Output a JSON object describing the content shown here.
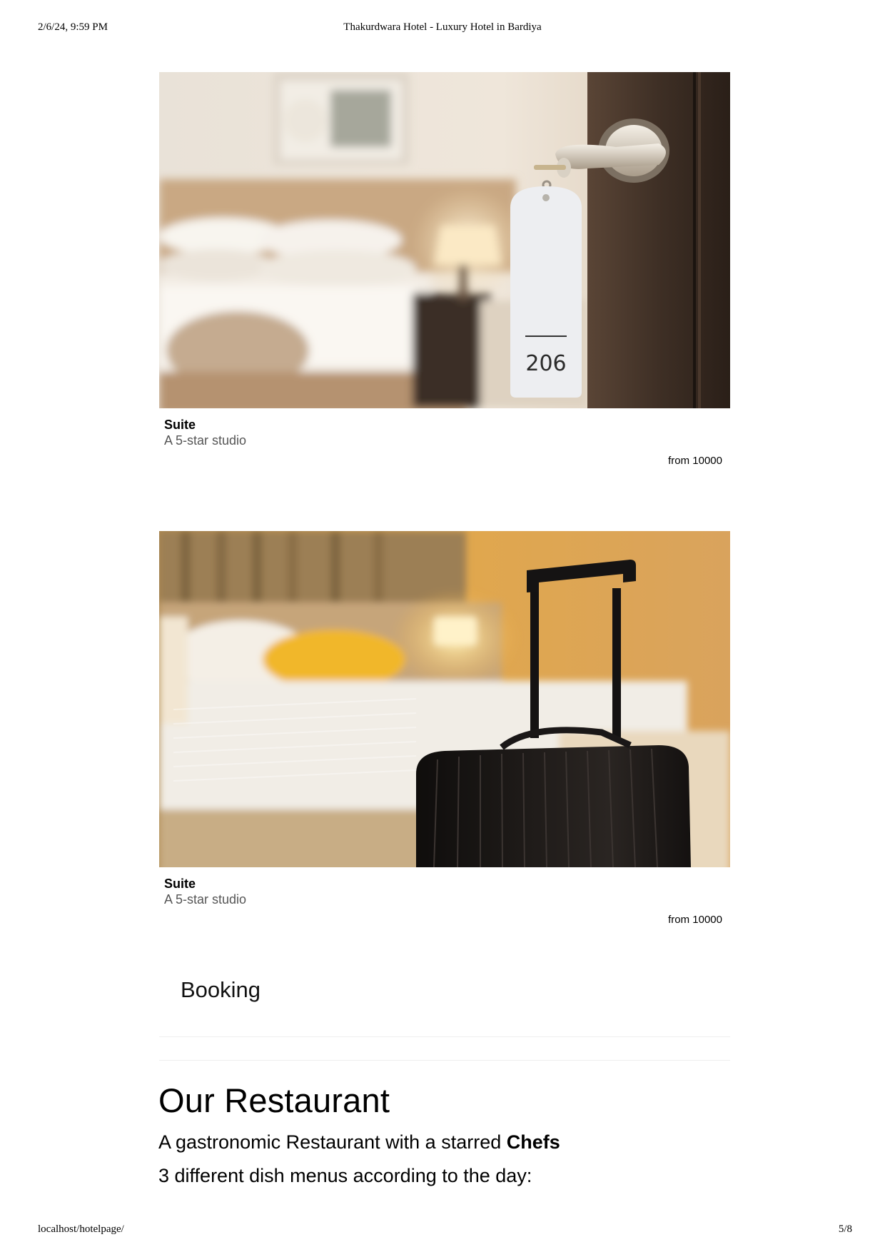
{
  "print_header": {
    "datetime": "2/6/24, 9:59 PM",
    "title": "Thakurdwara Hotel - Luxury Hotel in Bardiya"
  },
  "rooms": [
    {
      "title": "Suite",
      "subtitle": "A 5-star studio",
      "price": "from 10000",
      "image_text": "206"
    },
    {
      "title": "Suite",
      "subtitle": "A 5-star studio",
      "price": "from 10000"
    }
  ],
  "booking": {
    "label": "Booking"
  },
  "restaurant": {
    "title": "Our Restaurant",
    "line1_prefix": "A gastronomic Restaurant with a starred ",
    "line1_bold": "Chefs",
    "line2": "3 different dish menus according to the day:"
  },
  "print_footer": {
    "url": "localhost/hotelpage/",
    "page": "5/8"
  }
}
